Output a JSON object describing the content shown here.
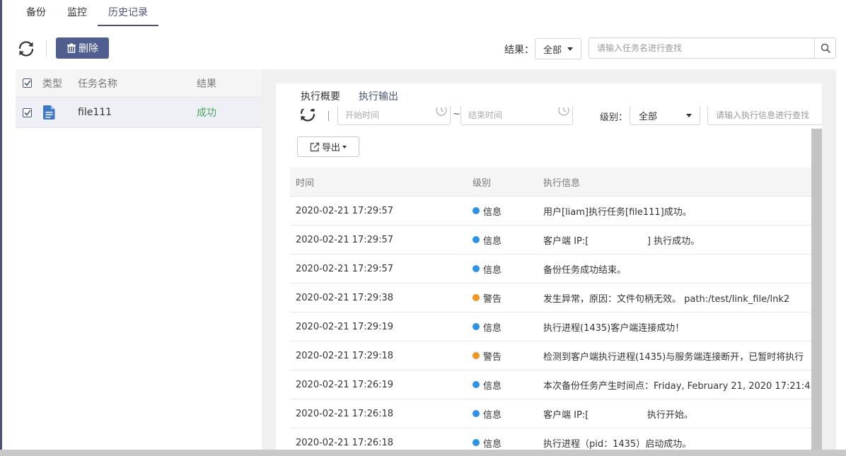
{
  "colors": {
    "accent": "#4a5378",
    "primary_button": "#4f5d8f",
    "success": "#4fa564",
    "info": "#2d93e6",
    "warning": "#f59324"
  },
  "tabs": [
    {
      "label": "备份"
    },
    {
      "label": "监控"
    },
    {
      "label": "历史记录",
      "active": true
    }
  ],
  "toolbar": {
    "delete_label": "删除",
    "result_label": "结果：",
    "result_select_value": "全部",
    "search_placeholder": "请输入任务名进行查找"
  },
  "task_list": {
    "headers": {
      "type": "类型",
      "name": "任务名称",
      "result": "结果"
    },
    "rows": [
      {
        "name": "file111",
        "result": "成功",
        "icon": "file-document-icon"
      }
    ]
  },
  "detail": {
    "tabs": [
      {
        "label": "执行概要"
      },
      {
        "label": "执行输出",
        "active": true
      }
    ],
    "start_placeholder": "开始时间",
    "end_placeholder": "结束时间",
    "tilde": "~",
    "level_label": "级别：",
    "level_value": "全部",
    "info_search_placeholder": "请输入执行信息进行查找",
    "export_label": "导出",
    "log_headers": {
      "time": "时间",
      "level": "级别",
      "message": "执行信息"
    },
    "logs": [
      {
        "time": "2020-02-21 17:29:57",
        "level": "信息",
        "severity": "info",
        "message": "用户[liam]执行任务[file111]成功。"
      },
      {
        "time": "2020-02-21 17:29:57",
        "level": "信息",
        "severity": "info",
        "message": "客户端 IP:[                    ] 执行成功。"
      },
      {
        "time": "2020-02-21 17:29:57",
        "level": "信息",
        "severity": "info",
        "message": "备份任务成功结束。"
      },
      {
        "time": "2020-02-21 17:29:38",
        "level": "警告",
        "severity": "warning",
        "message": "发生异常，原因：文件句柄无效。 path:/test/link_file/lnk2"
      },
      {
        "time": "2020-02-21 17:29:19",
        "level": "信息",
        "severity": "info",
        "message": "执行进程(1435)客户端连接成功！"
      },
      {
        "time": "2020-02-21 17:29:18",
        "level": "警告",
        "severity": "warning",
        "message": "检测到客户端执行进程(1435)与服务端连接断开，已暂时将执行"
      },
      {
        "time": "2020-02-21 17:26:19",
        "level": "信息",
        "severity": "info",
        "message": "本次备份任务产生时间点：Friday, February 21, 2020 17:21:4"
      },
      {
        "time": "2020-02-21 17:26:18",
        "level": "信息",
        "severity": "info",
        "message": "客户端 IP:[                    执行开始。"
      },
      {
        "time": "2020-02-21 17:26:18",
        "level": "信息",
        "severity": "info",
        "message": "执行进程（pid：1435）启动成功。"
      }
    ]
  }
}
